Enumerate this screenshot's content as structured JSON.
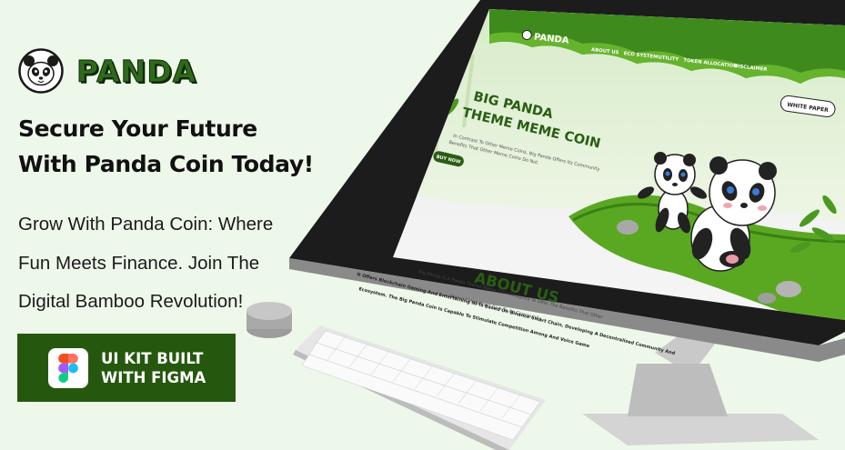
{
  "brand": {
    "name": "PANDA"
  },
  "headline": {
    "line1": "Secure Your Future",
    "line2": "With Panda Coin Today!"
  },
  "subtitle": {
    "line1": "Grow With Panda Coin: Where",
    "line2": "Fun Meets Finance. Join The",
    "line3": "Digital Bamboo Revolution!"
  },
  "cta": {
    "line1": "UI KIT BUILT",
    "line2": "WITH FIGMA",
    "icon": "figma-icon"
  },
  "mockup": {
    "logo": "PANDA",
    "nav": [
      "ABOUT US",
      "ECO SYSTEM",
      "UTILITY",
      "TOKEN ALLOCATION",
      "DISCLAIMER"
    ],
    "button": "WHITE PAPER",
    "hero_title_1": "BIG PANDA",
    "hero_title_2": "THEME MEME COIN",
    "hero_text_1": "In Contrast To Other Meme Coins, Big Panda Offers Its Community",
    "hero_text_2": "Benefits That Other Meme Coins Do Not.",
    "hero_button": "BUY NOW",
    "about_title": "ABOUT US",
    "about_text_1": "Big Panda Is A Panda Theme Meme Coin Designed To Offer The Benefits That Other",
    "about_text_2": "Meme Coins Don't Give To Its Community.",
    "about_text_3": "It Offers Blockchain Gaming And Entertaining NFTs Based On Binance Smart Chain, Developing A Decentralized Community And",
    "about_text_4": "Ecosystem. The Big Panda Coin Is Capable To Stimulate Competition Among And Voice Game"
  },
  "colors": {
    "accent": "#25580e",
    "brand_green": "#2f6a1c",
    "background": "#eef8ea",
    "screen_bezel": "#1c1c1c"
  }
}
